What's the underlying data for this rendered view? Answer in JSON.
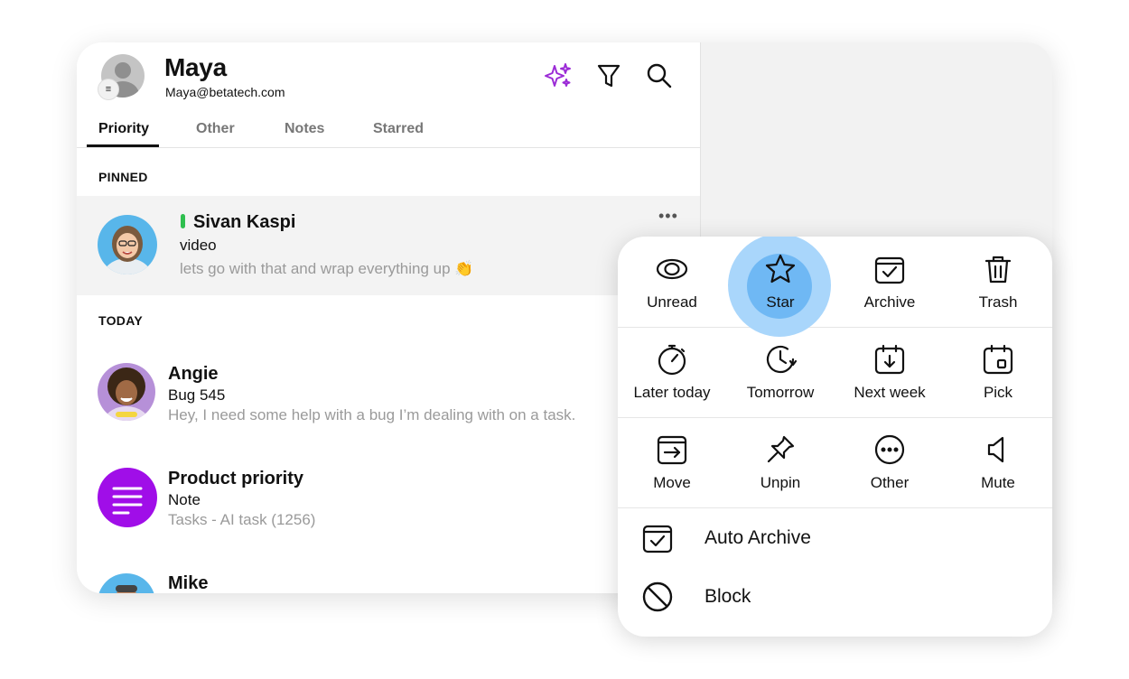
{
  "user": {
    "name": "Maya",
    "email": "Maya@betatech.com",
    "menu_icon": "≡"
  },
  "header_icons": [
    "sparkle-icon",
    "filter-icon",
    "search-icon"
  ],
  "colors": {
    "accent": "#9b2bd6",
    "online": "#2fbf4f",
    "highlight": "#6fb8f4",
    "note_avatar": "#a00ee8"
  },
  "tabs": [
    {
      "label": "Priority",
      "active": true
    },
    {
      "label": "Other"
    },
    {
      "label": "Notes"
    },
    {
      "label": "Starred"
    }
  ],
  "sections": {
    "pinned": "PINNED",
    "today": "TODAY"
  },
  "pinned": {
    "name": "Sivan Kaspi",
    "subject": "video",
    "preview": "lets go with that and wrap everything up 👏",
    "more": "•••"
  },
  "today": [
    {
      "name": "Angie",
      "subject": "Bug 545",
      "preview": "Hey, I need some help with a bug I’m dealing with on a task."
    },
    {
      "name": "Product priority",
      "subject": "Note",
      "preview": "Tasks - AI task (1256)"
    },
    {
      "name": "Mike"
    }
  ],
  "popup": {
    "row1": [
      {
        "label": "Unread",
        "icon": "eye-icon"
      },
      {
        "label": "Star",
        "icon": "star-icon"
      },
      {
        "label": "Archive",
        "icon": "archive-icon"
      },
      {
        "label": "Trash",
        "icon": "trash-icon"
      }
    ],
    "row2": [
      {
        "label": "Later today",
        "icon": "stopwatch-icon"
      },
      {
        "label": "Tomorrow",
        "icon": "clock-forward-icon"
      },
      {
        "label": "Next week",
        "icon": "calendar-down-icon"
      },
      {
        "label": "Pick",
        "icon": "calendar-pick-icon"
      }
    ],
    "row3": [
      {
        "label": "Move",
        "icon": "move-icon"
      },
      {
        "label": "Unpin",
        "icon": "unpin-icon"
      },
      {
        "label": "Other",
        "icon": "more-circle-icon"
      },
      {
        "label": "Mute",
        "icon": "mute-icon"
      }
    ],
    "auto_archive": "Auto Archive",
    "block": "Block"
  }
}
